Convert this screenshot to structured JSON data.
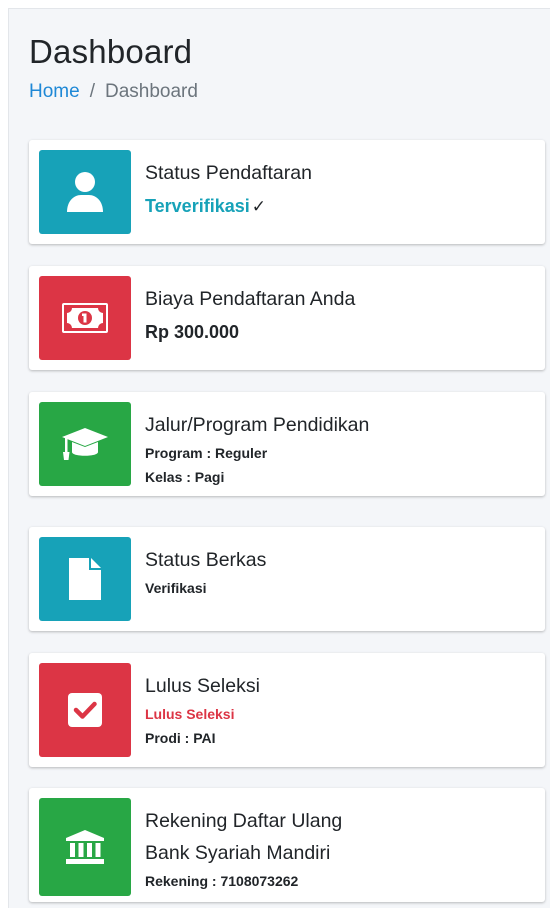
{
  "header": {
    "title": "Dashboard",
    "breadcrumb": {
      "home": "Home",
      "separator": "/",
      "current": "Dashboard"
    }
  },
  "cards": [
    {
      "title": "Status Pendaftaran",
      "value": "Terverifikasi",
      "value_suffix": "✓",
      "icon": "user-icon",
      "color": "#17a2b8"
    },
    {
      "title": "Biaya Pendaftaran Anda",
      "value": "Rp 300.000",
      "icon": "money-bill-icon",
      "color": "#dc3545"
    },
    {
      "title": "Jalur/Program Pendidikan",
      "line1": "Program : Reguler",
      "line2": "Kelas : Pagi",
      "icon": "graduation-cap-icon",
      "color": "#28a745"
    },
    {
      "title": "Status Berkas",
      "line1": "Verifikasi",
      "icon": "file-icon",
      "color": "#17a2b8"
    },
    {
      "title": "Lulus Seleksi",
      "line1": "Lulus Seleksi",
      "line2": "Prodi : PAI",
      "icon": "check-square-icon",
      "color": "#dc3545"
    },
    {
      "title": "Rekening Daftar Ulang",
      "subtitle": "Bank Syariah Mandiri",
      "line1": "Rekening : 7108073262",
      "icon": "bank-icon",
      "color": "#28a745"
    }
  ]
}
